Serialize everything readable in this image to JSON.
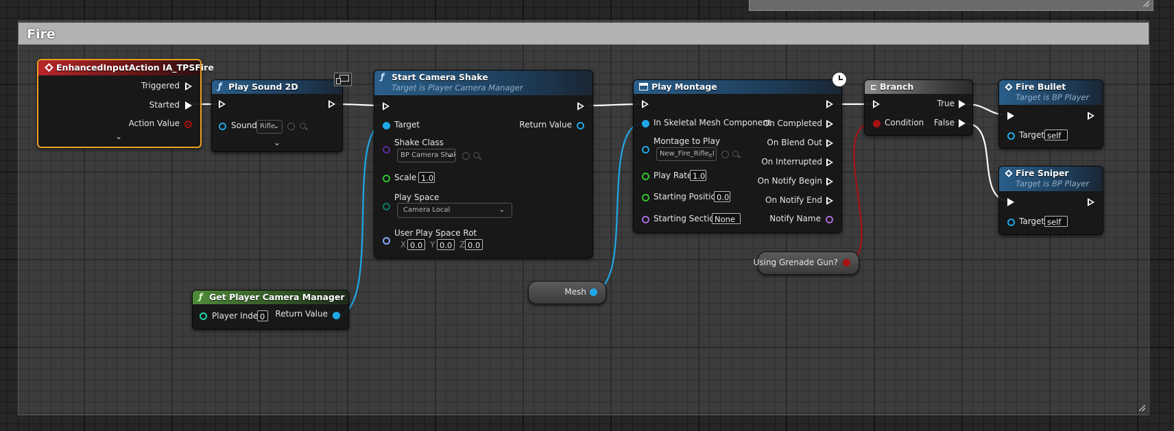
{
  "comment": {
    "title": "Fire"
  },
  "colors": {
    "exec": "#ffffff",
    "object": "#1fa8e8",
    "bool": "#a81212",
    "float": "#30c530",
    "name": "#a86bd8",
    "class": "#5a2a9a",
    "rotator": "#8aa8ff",
    "struct": "#0c7a6a",
    "int": "#1fd5b0"
  },
  "nodes": {
    "input_action": {
      "title": "EnhancedInputAction IA_TPSFire",
      "icon": "event-icon",
      "pins": {
        "triggered": "Triggered",
        "started": "Started",
        "action_value": "Action Value"
      }
    },
    "play_sound": {
      "title": "Play Sound 2D",
      "icon": "function-icon",
      "badge": "client-server-icon",
      "pins": {
        "sound": "Sound"
      },
      "sound_value": "Rifle"
    },
    "camera_shake": {
      "title": "Start Camera Shake",
      "subtitle": "Target is Player Camera Manager",
      "pins": {
        "target": "Target",
        "return_value": "Return Value",
        "shake_class": "Shake Class",
        "scale": "Scale",
        "play_space": "Play Space",
        "user_play_space_rot": "User Play Space Rot"
      },
      "shake_class_value": "BP Camera Shak",
      "scale_value": "1.0",
      "play_space_value": "Camera Local",
      "rot": {
        "x_label": "X",
        "y_label": "Y",
        "z_label": "Z",
        "x": "0.0",
        "y": "0.0",
        "z": "0.0"
      }
    },
    "camera_manager": {
      "title": "Get Player Camera Manager",
      "pins": {
        "player_index": "Player Index",
        "return_value": "Return Value"
      },
      "player_index_value": "0"
    },
    "mesh": {
      "label": "Mesh"
    },
    "play_montage": {
      "title": "Play Montage",
      "badge": "latent-clock-icon",
      "pins": {
        "skeletal_mesh": "In Skeletal Mesh Component",
        "montage": "Montage to Play",
        "play_rate": "Play Rate",
        "starting_position": "Starting Position",
        "starting_section": "Starting Section",
        "on_completed": "On Completed",
        "on_blend_out": "On Blend Out",
        "on_interrupted": "On Interrupted",
        "on_notify_begin": "On Notify Begin",
        "on_notify_end": "On Notify End",
        "notify_name": "Notify Name"
      },
      "montage_value": "New_Fire_Rifle_I",
      "play_rate_value": "1.0",
      "starting_position_value": "0.0",
      "starting_section_value": "None"
    },
    "grenade": {
      "label": "Using Grenade Gun?"
    },
    "branch": {
      "title": "Branch",
      "pins": {
        "true": "True",
        "false": "False",
        "condition": "Condition"
      }
    },
    "fire_bullet": {
      "title": "Fire Bullet",
      "subtitle": "Target is BP Player",
      "pins": {
        "target": "Target"
      },
      "target_value": "self"
    },
    "fire_sniper": {
      "title": "Fire Sniper",
      "subtitle": "Target is BP Player",
      "pins": {
        "target": "Target"
      },
      "target_value": "self"
    }
  }
}
